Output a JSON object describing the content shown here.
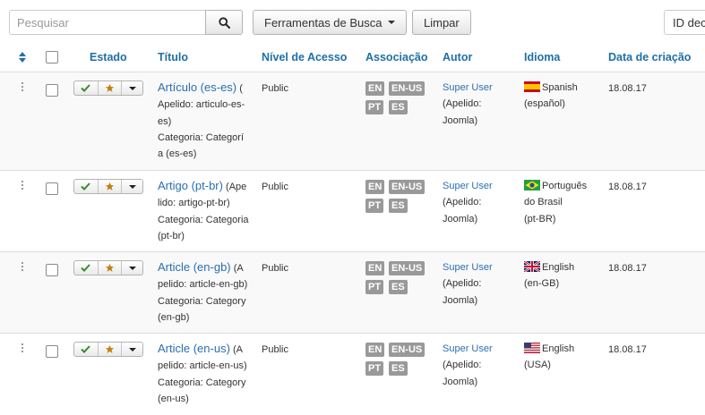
{
  "search": {
    "placeholder": "Pesquisar"
  },
  "toolbar": {
    "search_tools_label": "Ferramentas de Busca",
    "clear_label": "Limpar",
    "sort_value": "ID dec"
  },
  "columns": {
    "estado": "Estado",
    "titulo": "Título",
    "nivel": "Nível de Acesso",
    "associacao": "Associação",
    "autor": "Autor",
    "idioma": "Idioma",
    "data": "Data de criação"
  },
  "rows": [
    {
      "title": "Artículo (es-es)",
      "alias_lines": [
        " (",
        "Apelido: articulo-es-",
        "es)"
      ],
      "category_lines": [
        "Categoria: Categorí",
        "a (es-es)"
      ],
      "access": "Public",
      "associations": [
        "EN",
        "EN-US",
        "PT",
        "ES"
      ],
      "author": "Super User",
      "author_alias_lines": [
        "(Apelido:",
        "Joomla)"
      ],
      "language_lines": [
        "Spanish",
        "(español)"
      ],
      "flag": "es",
      "date": "18.08.17"
    },
    {
      "title": "Artigo (pt-br)",
      "alias_lines": [
        " (Ape",
        "lido: artigo-pt-br)"
      ],
      "category_lines": [
        "Categoria: Categoria",
        "(pt-br)"
      ],
      "access": "Public",
      "associations": [
        "EN",
        "EN-US",
        "PT",
        "ES"
      ],
      "author": "Super User",
      "author_alias_lines": [
        "(Apelido:",
        "Joomla)"
      ],
      "language_lines": [
        "Português",
        "do Brasil",
        "(pt-BR)"
      ],
      "flag": "br",
      "date": "18.08.17"
    },
    {
      "title": "Article (en-gb)",
      "alias_lines": [
        " (A",
        "pelido: article-en-gb)"
      ],
      "category_lines": [
        "Categoria: Category",
        "(en-gb)"
      ],
      "access": "Public",
      "associations": [
        "EN",
        "EN-US",
        "PT",
        "ES"
      ],
      "author": "Super User",
      "author_alias_lines": [
        "(Apelido:",
        "Joomla)"
      ],
      "language_lines": [
        "English",
        "(en-GB)"
      ],
      "flag": "gb",
      "date": "18.08.17"
    },
    {
      "title": "Article (en-us)",
      "alias_lines": [
        " (A",
        "pelido: article-en-us)"
      ],
      "category_lines": [
        "Categoria: Category",
        "(en-us)"
      ],
      "access": "Public",
      "associations": [
        "EN",
        "EN-US",
        "PT",
        "ES"
      ],
      "author": "Super User",
      "author_alias_lines": [
        "(Apelido:",
        "Joomla)"
      ],
      "language_lines": [
        "English",
        "(USA)"
      ],
      "flag": "us",
      "date": "18.08.17"
    }
  ],
  "colors": {
    "link": "#2a6fb0",
    "header": "#1f6fa6",
    "badge": "#999999",
    "published": "#3c8a2e",
    "featured": "#c77c0e"
  }
}
